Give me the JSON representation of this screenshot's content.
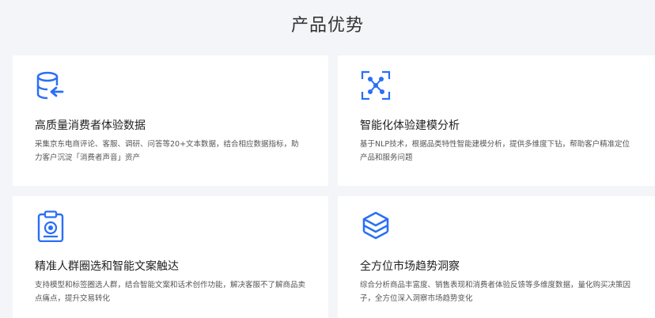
{
  "header": {
    "title": "产品优势"
  },
  "colors": {
    "accent": "#2a6ff6",
    "background": "#f3f5f9",
    "card": "#ffffff"
  },
  "cards": [
    {
      "icon": "database-import-icon",
      "title": "高质量消费者体验数据",
      "desc": "采集京东电商评论、客服、调研、问答等20+文本数据，结合相应数据指标，助力客户沉淀「消费者声音」资产"
    },
    {
      "icon": "network-graph-icon",
      "title": "智能化体验建模分析",
      "desc": "基于NLP技术，根据品类特性智能建模分析，提供多维度下钻，帮助客户精准定位产品和服务问题"
    },
    {
      "icon": "clipboard-target-icon",
      "title": "精准人群圈选和智能文案触达",
      "desc": "支持模型和标签圈选人群，结合智能文案和话术创作功能，解决客服不了解商品卖点痛点，提升交易转化"
    },
    {
      "icon": "layered-cube-icon",
      "title": "全方位市场趋势洞察",
      "desc": "综合分析商品丰富度、销售表现和消费者体验反馈等多维度数据，量化购买决策因子，全方位深入洞察市场趋势变化"
    }
  ]
}
